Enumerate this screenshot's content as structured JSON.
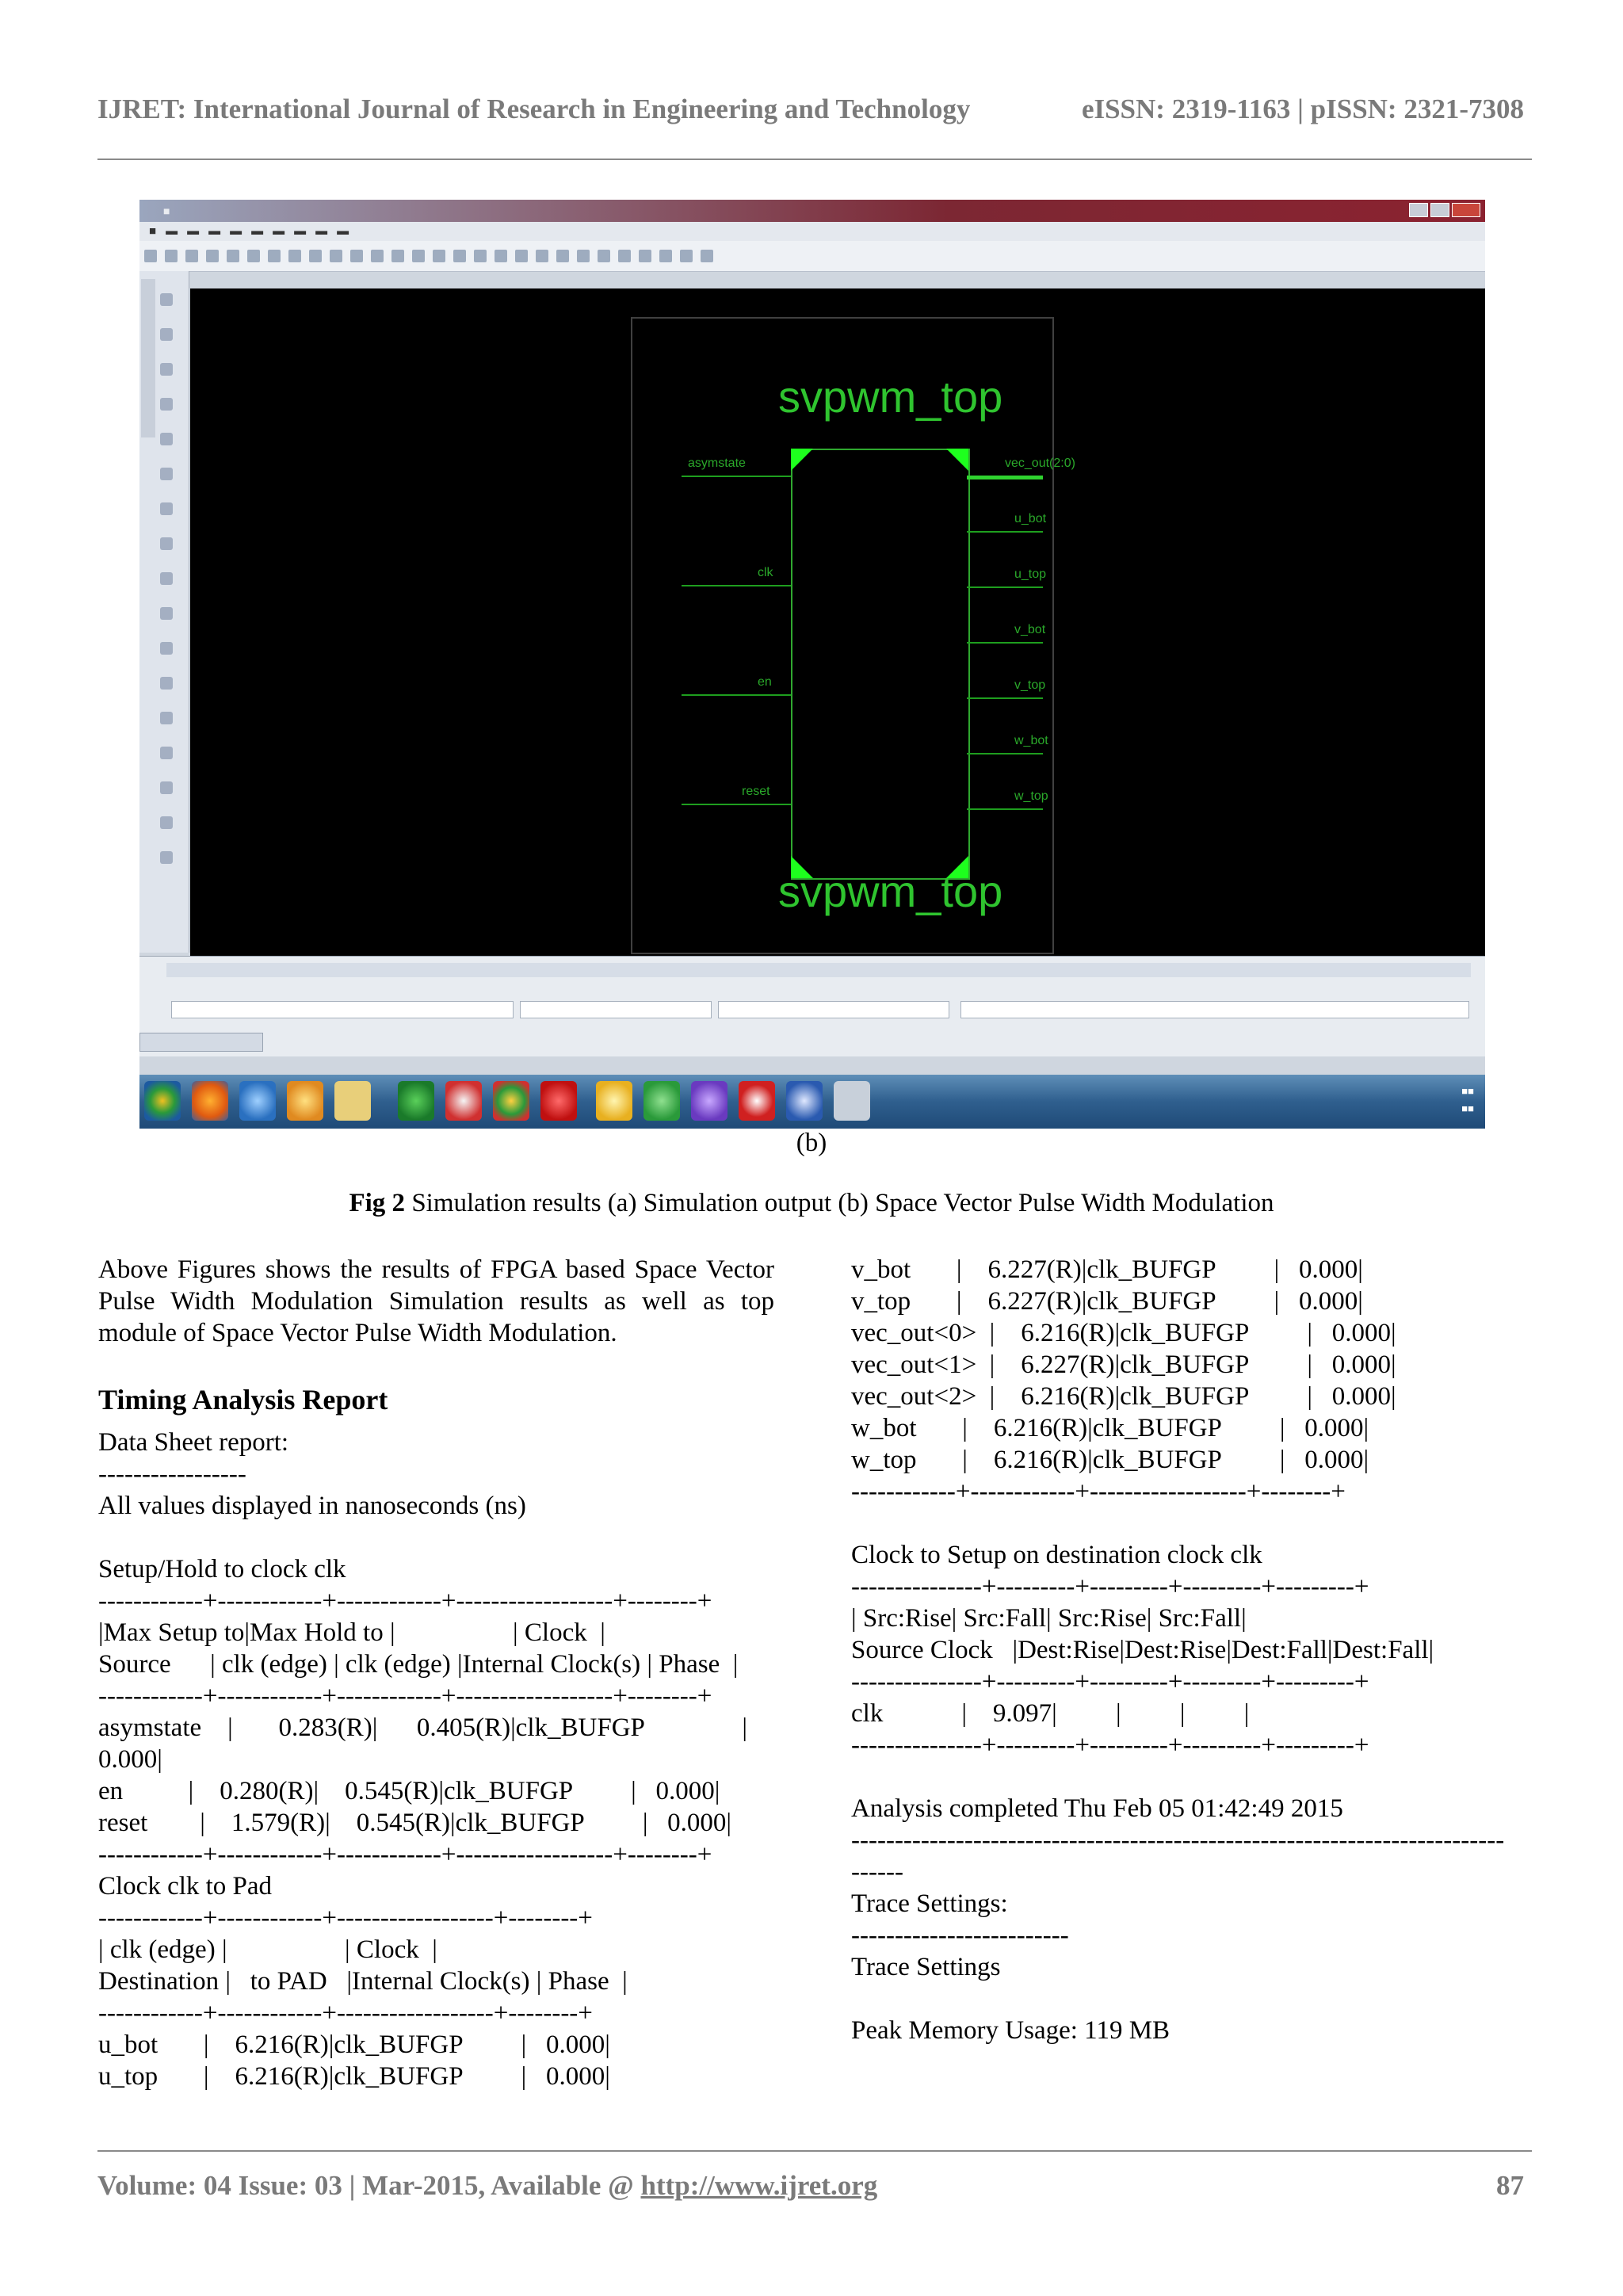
{
  "header": {
    "journal": "IJRET: International Journal of Research in Engineering and Technology",
    "issn": "eISSN: 2319-1163 | pISSN: 2321-7308"
  },
  "figure": {
    "block_name": "svpwm_top",
    "input_pins": [
      "asymstate",
      "clk",
      "en",
      "reset"
    ],
    "output_pins": [
      "vec_out(2:0)",
      "u_bot",
      "u_top",
      "v_bot",
      "v_top",
      "w_bot",
      "w_top"
    ],
    "subcaption": "(b)"
  },
  "fig_caption": {
    "label": "Fig 2",
    "text": " Simulation results (a) Simulation output (b) Space Vector Pulse Width Modulation"
  },
  "col1": {
    "paragraph": "Above Figures shows the results of FPGA based Space Vector Pulse Width Modulation Simulation results as well as top module of Space Vector Pulse Width Modulation.",
    "section_title": "Timing Analysis Report",
    "report_lines": [
      "Data Sheet report:",
      "-----------------",
      "All values displayed in nanoseconds (ns)",
      "",
      "Setup/Hold to clock clk",
      "------------+------------+------------+------------------+--------+",
      "|Max Setup to|Max Hold to |                  | Clock  |",
      "Source      | clk (edge) | clk (edge) |Internal Clock(s) | Phase  |",
      "------------+------------+------------+------------------+--------+",
      "asymstate    |       0.283(R)|      0.405(R)|clk_BUFGP               |",
      "0.000|",
      "en          |    0.280(R)|    0.545(R)|clk_BUFGP         |   0.000|",
      "reset        |    1.579(R)|    0.545(R)|clk_BUFGP         |   0.000|",
      "------------+------------+------------+------------------+--------+",
      "Clock clk to Pad",
      "------------+------------+------------------+--------+",
      "| clk (edge) |                  | Clock  |",
      "Destination |   to PAD   |Internal Clock(s) | Phase  |",
      "------------+------------+------------------+--------+",
      "u_bot       |    6.216(R)|clk_BUFGP         |   0.000|",
      "u_top       |    6.216(R)|clk_BUFGP         |   0.000|"
    ]
  },
  "col2": {
    "report_lines": [
      "v_bot       |    6.227(R)|clk_BUFGP         |   0.000|",
      "v_top       |    6.227(R)|clk_BUFGP         |   0.000|",
      "vec_out<0>  |    6.216(R)|clk_BUFGP         |   0.000|",
      "vec_out<1>  |    6.227(R)|clk_BUFGP         |   0.000|",
      "vec_out<2>  |    6.216(R)|clk_BUFGP         |   0.000|",
      "w_bot       |    6.216(R)|clk_BUFGP         |   0.000|",
      "w_top       |    6.216(R)|clk_BUFGP         |   0.000|",
      "------------+------------+------------------+--------+",
      "",
      "Clock to Setup on destination clock clk",
      "---------------+---------+---------+---------+---------+",
      "| Src:Rise| Src:Fall| Src:Rise| Src:Fall|",
      "Source Clock   |Dest:Rise|Dest:Rise|Dest:Fall|Dest:Fall|",
      "---------------+---------+---------+---------+---------+",
      "clk            |    9.097|         |         |         |",
      "---------------+---------+---------+---------+---------+",
      "",
      "Analysis completed Thu Feb 05 01:42:49 2015",
      "---------------------------------------------------------------------------",
      "------",
      "Trace Settings:",
      "-------------------------",
      "Trace Settings",
      "",
      "Peak Memory Usage: 119 MB"
    ]
  },
  "footer": {
    "volume": "Volume: 04 Issue: 03 | Mar-2015, Available @ ",
    "url": "http://www.ijret.org",
    "page": "87"
  }
}
